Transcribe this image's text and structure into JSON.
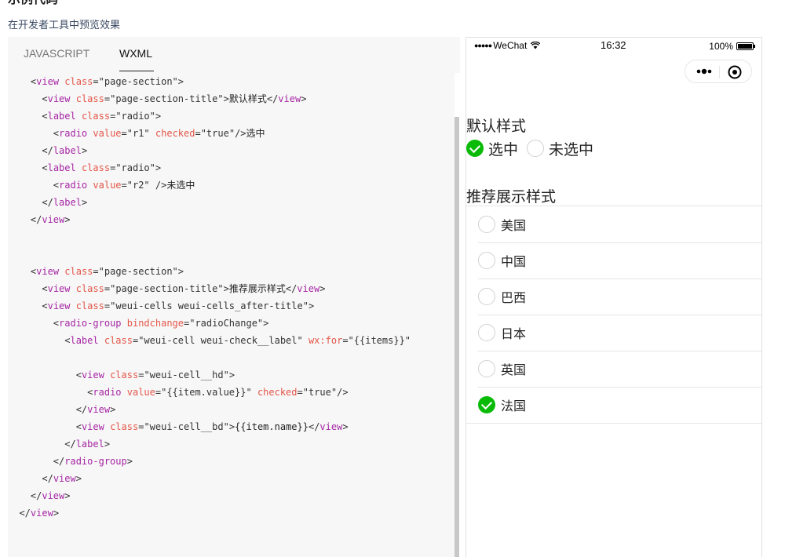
{
  "page": {
    "heading": "示例代码",
    "subtitle": "在开发者工具中预览效果"
  },
  "code_panel": {
    "tabs": [
      {
        "label": "JAVASCRIPT",
        "active": false
      },
      {
        "label": "WXML",
        "active": true
      }
    ],
    "lines": [
      {
        "indent": "    ",
        "tokens": [
          {
            "t": "punc",
            "v": "<"
          },
          {
            "t": "tag",
            "v": "view"
          },
          {
            "t": "punc",
            "v": " "
          },
          {
            "t": "attr",
            "v": "class"
          },
          {
            "t": "punc",
            "v": "="
          },
          {
            "t": "str",
            "v": "\"page-section\""
          },
          {
            "t": "punc",
            "v": ">"
          }
        ]
      },
      {
        "indent": "      ",
        "tokens": [
          {
            "t": "punc",
            "v": "<"
          },
          {
            "t": "tag",
            "v": "view"
          },
          {
            "t": "punc",
            "v": " "
          },
          {
            "t": "attr",
            "v": "class"
          },
          {
            "t": "punc",
            "v": "="
          },
          {
            "t": "str",
            "v": "\"page-section-title\""
          },
          {
            "t": "punc",
            "v": ">"
          },
          {
            "t": "text",
            "v": "默认样式"
          },
          {
            "t": "punc",
            "v": "</"
          },
          {
            "t": "tag",
            "v": "view"
          },
          {
            "t": "punc",
            "v": ">"
          }
        ]
      },
      {
        "indent": "      ",
        "tokens": [
          {
            "t": "punc",
            "v": "<"
          },
          {
            "t": "tag",
            "v": "label"
          },
          {
            "t": "punc",
            "v": " "
          },
          {
            "t": "attr",
            "v": "class"
          },
          {
            "t": "punc",
            "v": "="
          },
          {
            "t": "str",
            "v": "\"radio\""
          },
          {
            "t": "punc",
            "v": ">"
          }
        ]
      },
      {
        "indent": "        ",
        "tokens": [
          {
            "t": "punc",
            "v": "<"
          },
          {
            "t": "tag",
            "v": "radio"
          },
          {
            "t": "punc",
            "v": " "
          },
          {
            "t": "attr",
            "v": "value"
          },
          {
            "t": "punc",
            "v": "="
          },
          {
            "t": "str",
            "v": "\"r1\""
          },
          {
            "t": "punc",
            "v": " "
          },
          {
            "t": "attr",
            "v": "checked"
          },
          {
            "t": "punc",
            "v": "="
          },
          {
            "t": "str",
            "v": "\"true\""
          },
          {
            "t": "punc",
            "v": "/>"
          },
          {
            "t": "text",
            "v": "选中"
          }
        ]
      },
      {
        "indent": "      ",
        "tokens": [
          {
            "t": "punc",
            "v": "</"
          },
          {
            "t": "tag",
            "v": "label"
          },
          {
            "t": "punc",
            "v": ">"
          }
        ]
      },
      {
        "indent": "      ",
        "tokens": [
          {
            "t": "punc",
            "v": "<"
          },
          {
            "t": "tag",
            "v": "label"
          },
          {
            "t": "punc",
            "v": " "
          },
          {
            "t": "attr",
            "v": "class"
          },
          {
            "t": "punc",
            "v": "="
          },
          {
            "t": "str",
            "v": "\"radio\""
          },
          {
            "t": "punc",
            "v": ">"
          }
        ]
      },
      {
        "indent": "        ",
        "tokens": [
          {
            "t": "punc",
            "v": "<"
          },
          {
            "t": "tag",
            "v": "radio"
          },
          {
            "t": "punc",
            "v": " "
          },
          {
            "t": "attr",
            "v": "value"
          },
          {
            "t": "punc",
            "v": "="
          },
          {
            "t": "str",
            "v": "\"r2\""
          },
          {
            "t": "punc",
            "v": " />"
          },
          {
            "t": "text",
            "v": "未选中"
          }
        ]
      },
      {
        "indent": "      ",
        "tokens": [
          {
            "t": "punc",
            "v": "</"
          },
          {
            "t": "tag",
            "v": "label"
          },
          {
            "t": "punc",
            "v": ">"
          }
        ]
      },
      {
        "indent": "    ",
        "tokens": [
          {
            "t": "punc",
            "v": "</"
          },
          {
            "t": "tag",
            "v": "view"
          },
          {
            "t": "punc",
            "v": ">"
          }
        ]
      },
      {
        "indent": "",
        "tokens": []
      },
      {
        "indent": "",
        "tokens": []
      },
      {
        "indent": "    ",
        "tokens": [
          {
            "t": "punc",
            "v": "<"
          },
          {
            "t": "tag",
            "v": "view"
          },
          {
            "t": "punc",
            "v": " "
          },
          {
            "t": "attr",
            "v": "class"
          },
          {
            "t": "punc",
            "v": "="
          },
          {
            "t": "str",
            "v": "\"page-section\""
          },
          {
            "t": "punc",
            "v": ">"
          }
        ]
      },
      {
        "indent": "      ",
        "tokens": [
          {
            "t": "punc",
            "v": "<"
          },
          {
            "t": "tag",
            "v": "view"
          },
          {
            "t": "punc",
            "v": " "
          },
          {
            "t": "attr",
            "v": "class"
          },
          {
            "t": "punc",
            "v": "="
          },
          {
            "t": "str",
            "v": "\"page-section-title\""
          },
          {
            "t": "punc",
            "v": ">"
          },
          {
            "t": "text",
            "v": "推荐展示样式"
          },
          {
            "t": "punc",
            "v": "</"
          },
          {
            "t": "tag",
            "v": "view"
          },
          {
            "t": "punc",
            "v": ">"
          }
        ]
      },
      {
        "indent": "      ",
        "tokens": [
          {
            "t": "punc",
            "v": "<"
          },
          {
            "t": "tag",
            "v": "view"
          },
          {
            "t": "punc",
            "v": " "
          },
          {
            "t": "attr",
            "v": "class"
          },
          {
            "t": "punc",
            "v": "="
          },
          {
            "t": "str",
            "v": "\"weui-cells weui-cells_after-title\""
          },
          {
            "t": "punc",
            "v": ">"
          }
        ]
      },
      {
        "indent": "        ",
        "tokens": [
          {
            "t": "punc",
            "v": "<"
          },
          {
            "t": "tag",
            "v": "radio-group"
          },
          {
            "t": "punc",
            "v": " "
          },
          {
            "t": "attr",
            "v": "bindchange"
          },
          {
            "t": "punc",
            "v": "="
          },
          {
            "t": "str",
            "v": "\"radioChange\""
          },
          {
            "t": "punc",
            "v": ">"
          }
        ]
      },
      {
        "indent": "          ",
        "tokens": [
          {
            "t": "punc",
            "v": "<"
          },
          {
            "t": "tag",
            "v": "label"
          },
          {
            "t": "punc",
            "v": " "
          },
          {
            "t": "attr",
            "v": "class"
          },
          {
            "t": "punc",
            "v": "="
          },
          {
            "t": "str",
            "v": "\"weui-cell weui-check__label\""
          },
          {
            "t": "punc",
            "v": " "
          },
          {
            "t": "attr",
            "v": "wx:for"
          },
          {
            "t": "punc",
            "v": "="
          },
          {
            "t": "str",
            "v": "\"{{items}}\""
          }
        ]
      },
      {
        "indent": "",
        "tokens": []
      },
      {
        "indent": "            ",
        "tokens": [
          {
            "t": "punc",
            "v": "<"
          },
          {
            "t": "tag",
            "v": "view"
          },
          {
            "t": "punc",
            "v": " "
          },
          {
            "t": "attr",
            "v": "class"
          },
          {
            "t": "punc",
            "v": "="
          },
          {
            "t": "str",
            "v": "\"weui-cell__hd\""
          },
          {
            "t": "punc",
            "v": ">"
          }
        ]
      },
      {
        "indent": "              ",
        "tokens": [
          {
            "t": "punc",
            "v": "<"
          },
          {
            "t": "tag",
            "v": "radio"
          },
          {
            "t": "punc",
            "v": " "
          },
          {
            "t": "attr",
            "v": "value"
          },
          {
            "t": "punc",
            "v": "="
          },
          {
            "t": "str",
            "v": "\"{{item.value}}\""
          },
          {
            "t": "punc",
            "v": " "
          },
          {
            "t": "attr",
            "v": "checked"
          },
          {
            "t": "punc",
            "v": "="
          },
          {
            "t": "str",
            "v": "\"true\""
          },
          {
            "t": "punc",
            "v": "/>"
          }
        ]
      },
      {
        "indent": "            ",
        "tokens": [
          {
            "t": "punc",
            "v": "</"
          },
          {
            "t": "tag",
            "v": "view"
          },
          {
            "t": "punc",
            "v": ">"
          }
        ]
      },
      {
        "indent": "            ",
        "tokens": [
          {
            "t": "punc",
            "v": "<"
          },
          {
            "t": "tag",
            "v": "view"
          },
          {
            "t": "punc",
            "v": " "
          },
          {
            "t": "attr",
            "v": "class"
          },
          {
            "t": "punc",
            "v": "="
          },
          {
            "t": "str",
            "v": "\"weui-cell__bd\""
          },
          {
            "t": "punc",
            "v": ">"
          },
          {
            "t": "text",
            "v": "{{item.name}}"
          },
          {
            "t": "punc",
            "v": "</"
          },
          {
            "t": "tag",
            "v": "view"
          },
          {
            "t": "punc",
            "v": ">"
          }
        ]
      },
      {
        "indent": "          ",
        "tokens": [
          {
            "t": "punc",
            "v": "</"
          },
          {
            "t": "tag",
            "v": "label"
          },
          {
            "t": "punc",
            "v": ">"
          }
        ]
      },
      {
        "indent": "        ",
        "tokens": [
          {
            "t": "punc",
            "v": "</"
          },
          {
            "t": "tag",
            "v": "radio-group"
          },
          {
            "t": "punc",
            "v": ">"
          }
        ]
      },
      {
        "indent": "      ",
        "tokens": [
          {
            "t": "punc",
            "v": "</"
          },
          {
            "t": "tag",
            "v": "view"
          },
          {
            "t": "punc",
            "v": ">"
          }
        ]
      },
      {
        "indent": "    ",
        "tokens": [
          {
            "t": "punc",
            "v": "</"
          },
          {
            "t": "tag",
            "v": "view"
          },
          {
            "t": "punc",
            "v": ">"
          }
        ]
      },
      {
        "indent": "  ",
        "tokens": [
          {
            "t": "punc",
            "v": "</"
          },
          {
            "t": "tag",
            "v": "view"
          },
          {
            "t": "punc",
            "v": ">"
          }
        ]
      }
    ]
  },
  "phone": {
    "status": {
      "signal": "●●●●●",
      "carrier": "WeChat",
      "time": "16:32",
      "battery": "100%"
    },
    "capsule": {
      "more_icon": "more-dots-icon",
      "close_icon": "target-circle-icon"
    },
    "section1": {
      "title": "默认样式",
      "radios": [
        {
          "label": "选中",
          "checked": true
        },
        {
          "label": "未选中",
          "checked": false
        }
      ]
    },
    "section2": {
      "title": "推荐展示样式",
      "items": [
        {
          "name": "美国",
          "checked": false
        },
        {
          "name": "中国",
          "checked": false
        },
        {
          "name": "巴西",
          "checked": false
        },
        {
          "name": "日本",
          "checked": false
        },
        {
          "name": "英国",
          "checked": false
        },
        {
          "name": "法国",
          "checked": true
        }
      ]
    },
    "colors": {
      "checked": "#09bb07",
      "border": "#d1d1d1"
    }
  }
}
